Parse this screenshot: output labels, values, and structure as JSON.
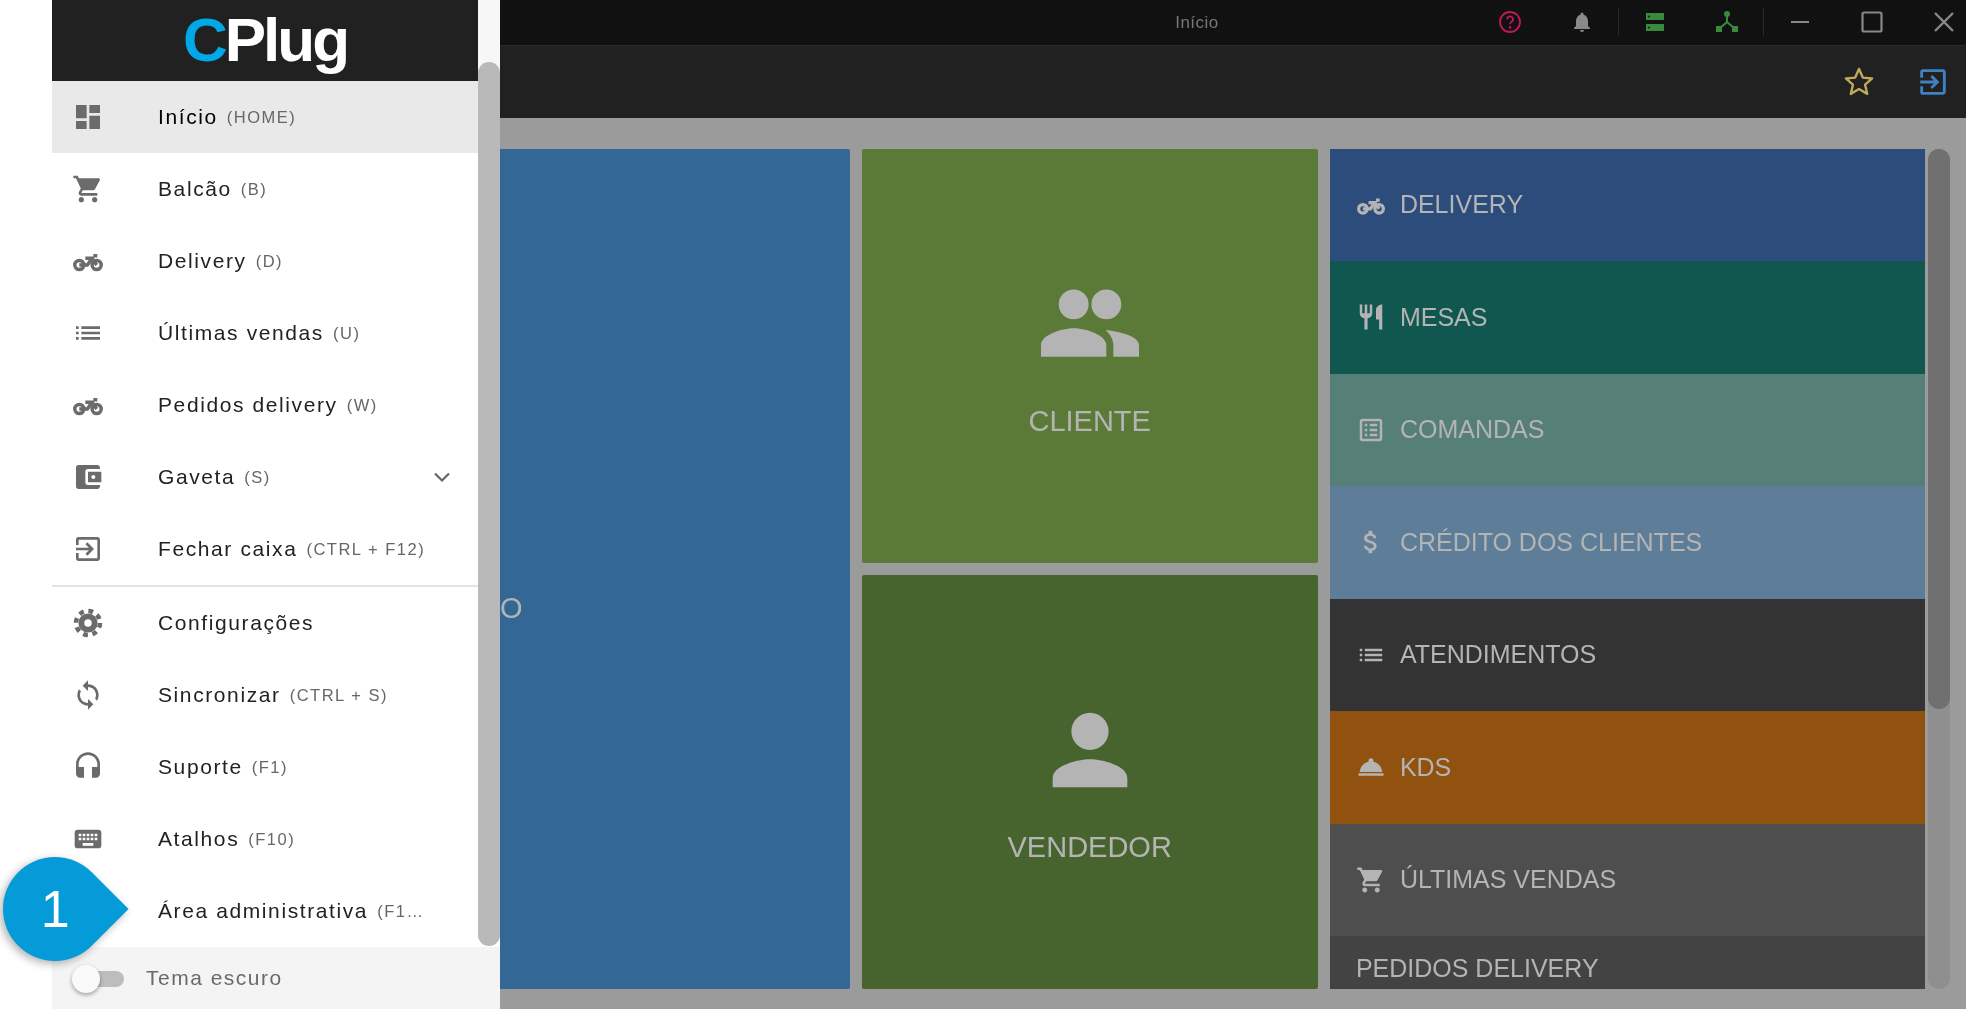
{
  "window": {
    "title": "Início"
  },
  "drawer": {
    "logo": {
      "accent": "C",
      "rest": "Plug"
    },
    "menu_groups": [
      {
        "items": [
          {
            "label": "Início",
            "shortcut": "(HOME)",
            "kind": "link",
            "selected": true
          },
          {
            "label": "Balcão",
            "shortcut": "(B)",
            "kind": "link",
            "selected": false
          },
          {
            "label": "Delivery",
            "shortcut": "(D)",
            "kind": "link",
            "selected": false
          },
          {
            "label": "Últimas vendas",
            "shortcut": "(U)",
            "kind": "link",
            "selected": false
          },
          {
            "label": "Pedidos delivery",
            "shortcut": "(W)",
            "kind": "link",
            "selected": false
          },
          {
            "label": "Gaveta",
            "shortcut": "(S)",
            "kind": "submenu",
            "selected": false
          },
          {
            "label": "Fechar caixa",
            "shortcut": "(CTRL + F12)",
            "kind": "link",
            "selected": false
          }
        ]
      },
      {
        "items": [
          {
            "label": "Configurações",
            "kind": "link",
            "selected": false
          },
          {
            "label": "Sincronizar",
            "shortcut": "(CTRL + S)",
            "kind": "link",
            "selected": false
          },
          {
            "label": "Suporte",
            "shortcut": "(F1)",
            "kind": "link",
            "selected": false
          },
          {
            "label": "Atalhos",
            "shortcut": "(F10)",
            "kind": "link",
            "selected": false
          },
          {
            "label": "Área administrativa",
            "shortcut": "(F1…",
            "kind": "link",
            "selected": false
          }
        ]
      }
    ],
    "dark_theme": {
      "label": "Tema escuro",
      "on": false
    }
  },
  "callout": {
    "label": "1"
  },
  "tiles": [
    {
      "label": "O",
      "color": "#336896"
    },
    {
      "label": "CLIENTE",
      "color": "#5b7a37"
    },
    {
      "label": "VENDEDOR",
      "color": "#47642f"
    }
  ],
  "shortcuts": [
    {
      "label": "DELIVERY",
      "color": "#2c4c7b"
    },
    {
      "label": "MESAS",
      "color": "#10574f"
    },
    {
      "label": "COMANDAS",
      "color": "#567f78"
    },
    {
      "label": "CRÉDITO DOS CLIENTES",
      "color": "#5e7d98"
    },
    {
      "label": "ATENDIMENTOS",
      "color": "#333333"
    },
    {
      "label": "KDS",
      "color": "#91520f"
    },
    {
      "label": "ÚLTIMAS VENDAS",
      "color": "#4e4e4e"
    },
    {
      "label": "PEDIDOS DELIVERY",
      "color": "#434343"
    }
  ]
}
